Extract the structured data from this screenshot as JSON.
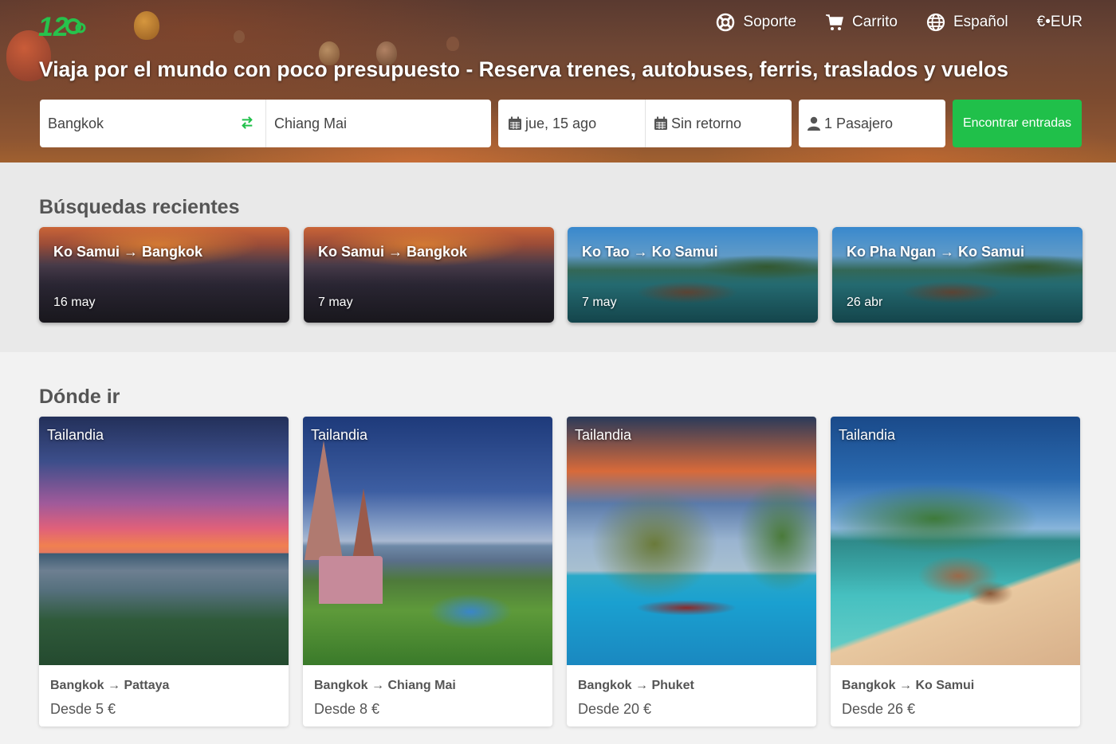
{
  "header": {
    "logo_text": "12Go",
    "nav": [
      {
        "label": "Soporte",
        "icon": "lifebuoy-icon"
      },
      {
        "label": "Carrito",
        "icon": "cart-icon"
      },
      {
        "label": "Español",
        "icon": "globe-icon"
      },
      {
        "label": "€•EUR",
        "icon": ""
      }
    ],
    "title": "Viaja por el mundo con poco presupuesto - Reserva trenes, autobuses, ferris, traslados y vuelos"
  },
  "search": {
    "from": "Bangkok",
    "to": "Chiang Mai",
    "date": "jue, 15 ago",
    "return": "Sin retorno",
    "passengers": "1 Pasajero",
    "button": "Encontrar entradas"
  },
  "recent": {
    "title": "Búsquedas recientes",
    "items": [
      {
        "route": "Ko Samui → Bangkok",
        "date": "16 may",
        "scene": "city"
      },
      {
        "route": "Ko Samui → Bangkok",
        "date": "7 may",
        "scene": "city"
      },
      {
        "route": "Ko Tao → Ko Samui",
        "date": "7 may",
        "scene": "sea"
      },
      {
        "route": "Ko Pha Ngan → Ko Samui",
        "date": "26 abr",
        "scene": "sea"
      }
    ]
  },
  "destinations": {
    "title": "Dónde ir",
    "items": [
      {
        "country": "Tailandia",
        "route": "Bangkok → Pattaya",
        "price": "Desde 5 €"
      },
      {
        "country": "Tailandia",
        "route": "Bangkok → Chiang Mai",
        "price": "Desde 8 €"
      },
      {
        "country": "Tailandia",
        "route": "Bangkok → Phuket",
        "price": "Desde 20 €"
      },
      {
        "country": "Tailandia",
        "route": "Bangkok → Ko Samui",
        "price": "Desde 26 €"
      }
    ]
  },
  "colors": {
    "accent": "#20c04a",
    "heading": "#555555",
    "recent_bg": "#e9e9e9",
    "page_bg": "#f2f2f2"
  }
}
